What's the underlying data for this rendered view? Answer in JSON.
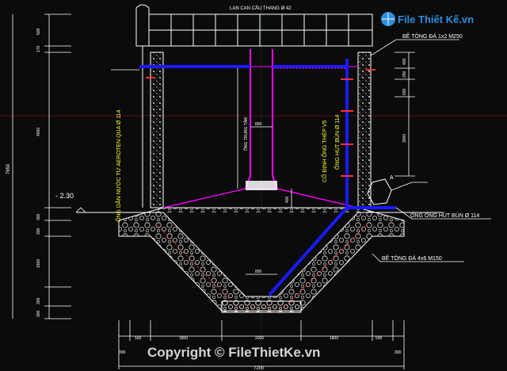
{
  "labels": {
    "railing": "LAN CAN CẦU THANG Ø 42",
    "concrete_top": "BÊ TÔNG ĐÁ 1x2 M250",
    "inlet_pipe": "ỐNG DẪN NƯỚC TỪ AEROTEN QUA Ø 114",
    "center_pipe": "ỐNG TRUNG TÂM",
    "steel_fix": "CỐ ĐỊNH ỐNG THÉP V5",
    "sludge_pipe_v": "ỐNG HÚT BÙN Ø 114",
    "sludge_pipe_out": "ỐNG ỐNG HÚT BÙN Ø 114",
    "concrete_bottom": "BÊ TÔNG ĐÁ 4x6 M150",
    "level": "- 2.30",
    "detail_a": "A",
    "watermark": "Copyright © FileThietKe.vn",
    "logo": "File Thiết Kế.vn"
  },
  "dims": {
    "left_total": "7650",
    "left": [
      "500",
      "170",
      "4000",
      "300",
      "300",
      "1500",
      "300",
      "300"
    ],
    "right": [
      "400",
      "250",
      "600",
      "3000"
    ],
    "center_top": "800",
    "center_bottom": "800",
    "cone_h": "400",
    "bottom": [
      "300",
      "500",
      "1800",
      "2000",
      "1800",
      "500",
      "300"
    ],
    "bottom_total": "7200"
  },
  "colors": {
    "wall": "#ffffff",
    "pipe": "#1a1aff",
    "magenta": "#ff00ff",
    "dim": "#ffffff",
    "accent_red": "#ff3030",
    "label_yellow": "#ffff33",
    "label_white": "#ffffff"
  }
}
